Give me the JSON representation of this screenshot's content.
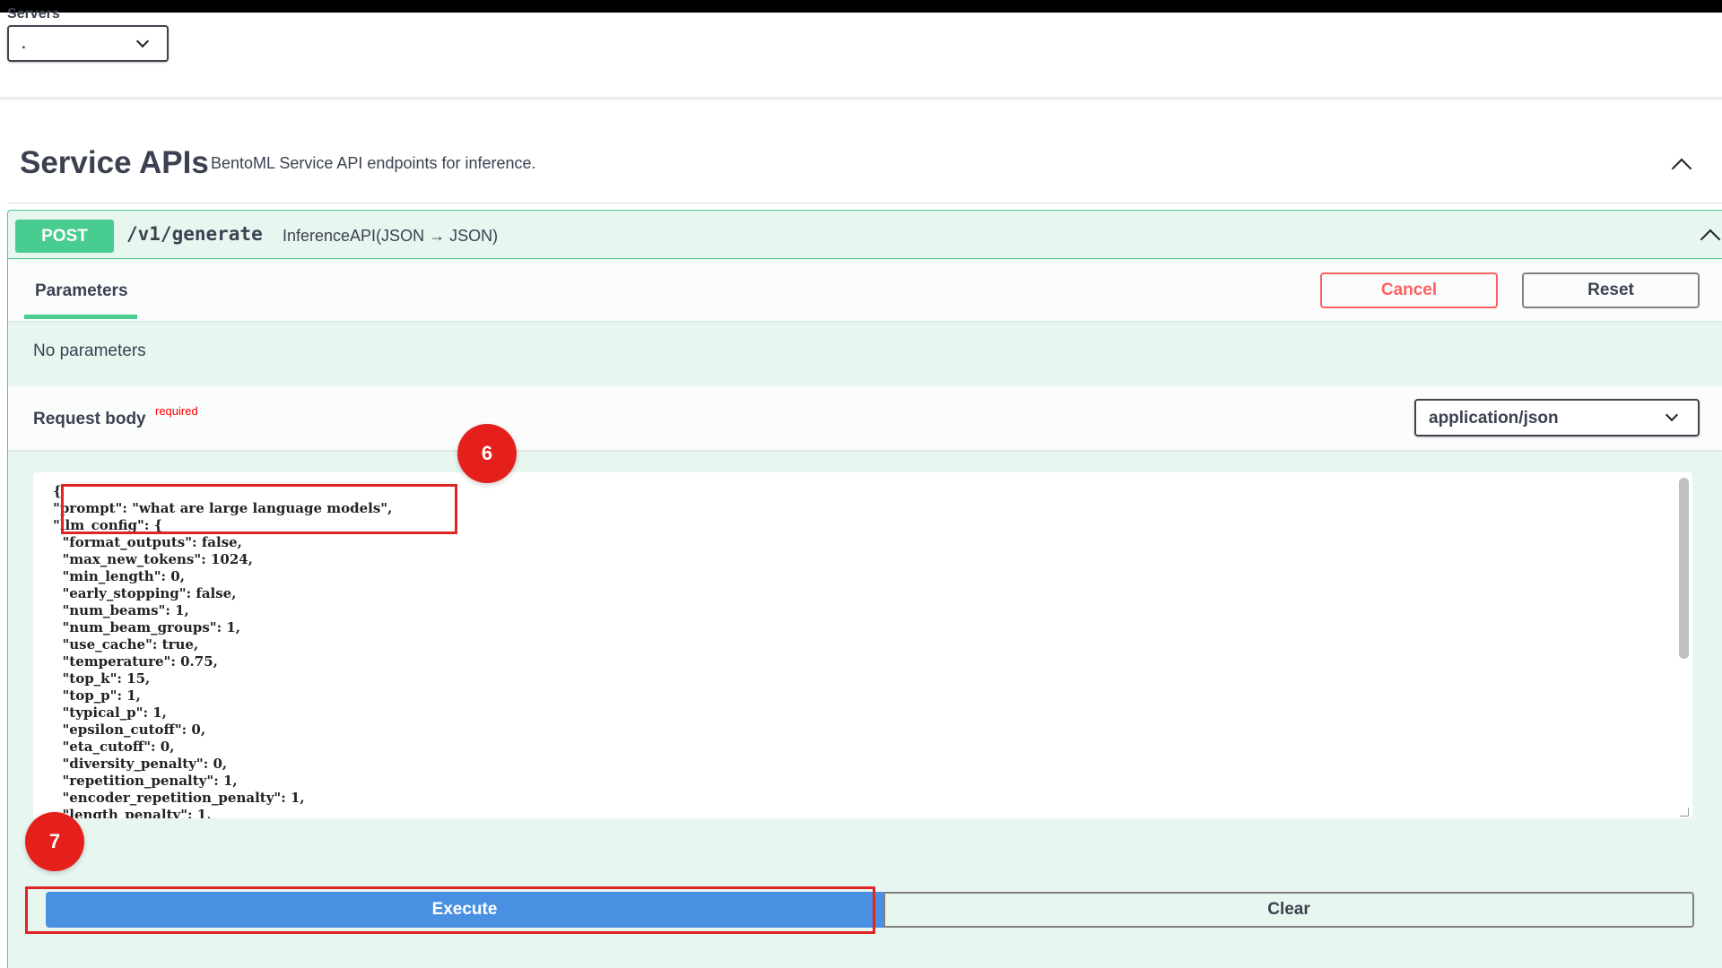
{
  "servers": {
    "label": "Servers",
    "selected": "."
  },
  "tag": {
    "title": "Service APIs",
    "description": "BentoML Service API endpoints for inference."
  },
  "operation": {
    "method": "POST",
    "path": "/v1/generate",
    "summary": "InferenceAPI(JSON → JSON)",
    "method_color": "#49cc90"
  },
  "parameters": {
    "tab_label": "Parameters",
    "cancel_label": "Cancel",
    "reset_label": "Reset",
    "empty_text": "No parameters"
  },
  "request_body": {
    "label": "Request body",
    "required_label": "required",
    "content_type": "application/json",
    "code": "{\n\"prompt\": \"what are large language models\",\n\"llm_config\": {\n  \"format_outputs\": false,\n  \"max_new_tokens\": 1024,\n  \"min_length\": 0,\n  \"early_stopping\": false,\n  \"num_beams\": 1,\n  \"num_beam_groups\": 1,\n  \"use_cache\": true,\n  \"temperature\": 0.75,\n  \"top_k\": 15,\n  \"top_p\": 1,\n  \"typical_p\": 1,\n  \"epsilon_cutoff\": 0,\n  \"eta_cutoff\": 0,\n  \"diversity_penalty\": 0,\n  \"repetition_penalty\": 1,\n  \"encoder_repetition_penalty\": 1,\n  \"length_penalty\": 1,"
  },
  "actions": {
    "execute_label": "Execute",
    "clear_label": "Clear"
  },
  "annotations": {
    "step_6": "6",
    "step_7": "7",
    "highlight_color": "#e02424"
  }
}
